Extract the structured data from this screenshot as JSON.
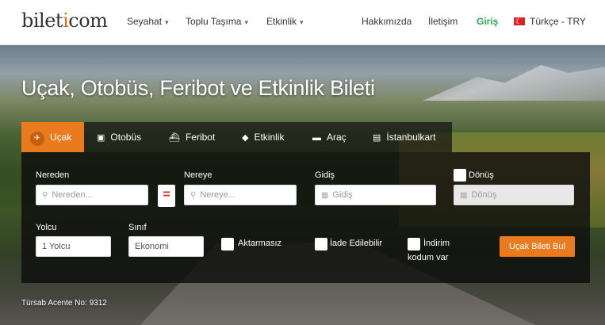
{
  "logo": {
    "pre": "bilet",
    "dot": "i",
    "post": "com"
  },
  "nav": {
    "travel": "Seyahat",
    "transit": "Toplu Taşıma",
    "events": "Etkinlik",
    "about": "Hakkımızda",
    "contact": "İletişim",
    "login": "Giriş",
    "locale": "Türkçe - TRY"
  },
  "hero": {
    "title": "Uçak, Otobüs, Feribot ve Etkinlik Bileti"
  },
  "tabs": [
    {
      "label": "Uçak",
      "icon": "plane-icon"
    },
    {
      "label": "Otobüs",
      "icon": "bus-icon"
    },
    {
      "label": "Feribot",
      "icon": "ferry-icon"
    },
    {
      "label": "Etkinlik",
      "icon": "ticket-icon"
    },
    {
      "label": "Araç",
      "icon": "car-icon"
    },
    {
      "label": "İstanbulkart",
      "icon": "card-icon"
    }
  ],
  "form": {
    "from_label": "Nereden",
    "from_placeholder": "Nereden...",
    "to_label": "Nereye",
    "to_placeholder": "Nereye...",
    "depart_label": "Gidiş",
    "depart_placeholder": "Gidiş",
    "return_label": "Dönüş",
    "return_placeholder": "Dönüş",
    "passenger_label": "Yolcu",
    "passenger_value": "1 Yolcu",
    "class_label": "Sınıf",
    "class_value": "Ekonomi",
    "nonstop_label": "Aktarmasız",
    "refundable_label": "İade Edilebilir",
    "discount_label_line1": "İndirim",
    "discount_label_line2": "kodum var",
    "search_button": "Uçak Bileti Bul"
  },
  "footer": {
    "agency": "Türsab Acente No: 9312"
  },
  "colors": {
    "accent": "#e97a1e",
    "green": "#2aa74f",
    "red": "#d8232a"
  }
}
